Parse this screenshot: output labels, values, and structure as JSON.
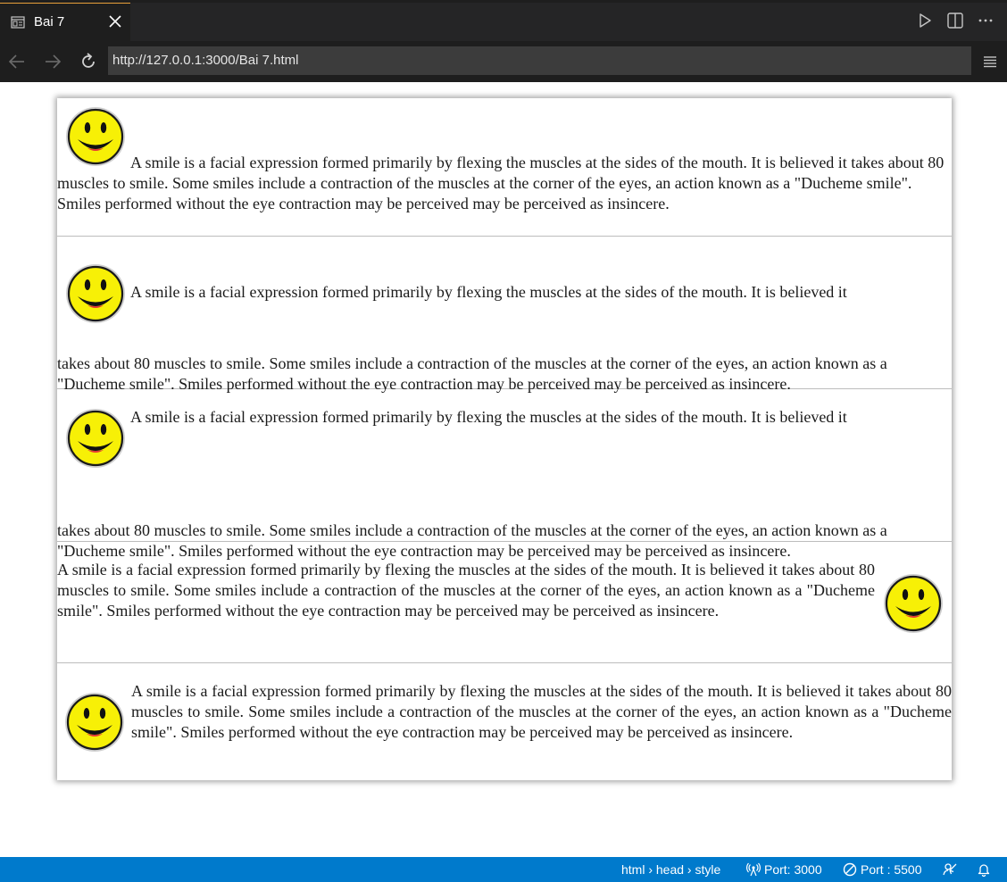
{
  "tab": {
    "title": "Bai 7"
  },
  "address": {
    "url": "http://127.0.0.1:3000/Bai 7.html"
  },
  "content": {
    "paragraph_line1": "A smile is a facial expression formed primarily by flexing the muscles at the sides of the mouth. It is believed it",
    "paragraph_line2": "takes about 80 muscles to smile. Some smiles include a contraction of the muscles at the corner of the eyes, an action known as a \"Ducheme smile\". Smiles performed without the eye contraction may be perceived may be perceived as insincere.",
    "paragraph_full": "A smile is a facial expression formed primarily by flexing the muscles at the sides of the mouth. It is believed it takes about 80 muscles to smile. Some smiles include a contraction of the muscles at the corner of the eyes, an action known as a \"Ducheme smile\". Smiles performed without the eye contraction may be perceived may be perceived as insincere."
  },
  "statusbar": {
    "breadcrumb": "html › head › style",
    "port_live": "Port: 3000",
    "port_other": "Port : 5500"
  },
  "icons": {
    "smiley": "smiley-face-icon",
    "tab": "preview-icon",
    "close": "close-icon",
    "run": "play-icon",
    "split": "split-editor-icon",
    "more": "more-actions-icon",
    "back": "arrow-left-icon",
    "forward": "arrow-right-icon",
    "reload": "reload-icon",
    "menu": "menu-icon",
    "broadcast": "broadcast-icon",
    "blocked": "blocked-circle-icon",
    "feedback": "feedback-icon",
    "bell": "bell-icon"
  },
  "colors": {
    "accent": "#007acc",
    "smiley_face": "#f7f006",
    "tab_border": "#e8a03a"
  }
}
